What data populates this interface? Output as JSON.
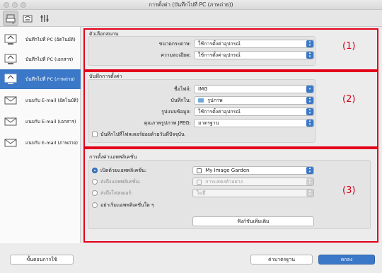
{
  "window": {
    "title": "การตั้งค่า (บันทึกไปที่ PC (ภาพถ่าย))"
  },
  "toolbar": {
    "icons": [
      "scan-settings-icon",
      "general-settings-icon",
      "tools-icon"
    ]
  },
  "sidebar": {
    "items": [
      {
        "label": "บันทึกไปที่ PC (อัตโนมัติ)",
        "icon": "save-to-pc-icon"
      },
      {
        "label": "บันทึกไปที่ PC (เอกสาร)",
        "icon": "save-to-pc-icon"
      },
      {
        "label": "บันทึกไปที่ PC (ภาพถ่าย)",
        "icon": "save-to-pc-icon"
      },
      {
        "label": "แนบกับ E-mail (อัตโนมัติ)",
        "icon": "email-icon"
      },
      {
        "label": "แนบกับ E-mail (เอกสาร)",
        "icon": "email-icon"
      },
      {
        "label": "แนบกับ E-mail (ภาพถ่าย)",
        "icon": "email-icon"
      }
    ],
    "selected_index": 2
  },
  "scan_options": {
    "title": "ตัวเลือกสแกน",
    "paper_size_label": "ขนาดกระดาษ:",
    "paper_size_value": "ใช้การตั้งค่าอุปกรณ์",
    "resolution_label": "ความละเอียด:",
    "resolution_value": "ใช้การตั้งค่าอุปกรณ์",
    "marker": "(1)"
  },
  "save_settings": {
    "title": "บันทึกการตั้งค่า",
    "file_name_label": "ชื่อไฟล์:",
    "file_name_value": "IMG",
    "save_in_label": "บันทึกใน:",
    "save_in_value": "รูปภาพ",
    "data_format_label": "รูปแบบข้อมูล:",
    "data_format_value": "ใช้การตั้งค่าอุปกรณ์",
    "jpeg_quality_label": "คุณภาพรูปภาพ JPEG:",
    "jpeg_quality_value": "มาตรฐาน",
    "subfolder_label": "บันทึกไปที่โฟลเดอร์ย่อยด้วยวันที่ปัจจุบัน",
    "subfolder_checked": false,
    "marker": "(2)"
  },
  "app_settings": {
    "title": "การตั้งค่าแอพพลิเคชั่น",
    "open_with_label": "เปิดด้วยแอพพลิเคชั่น:",
    "open_with_value": "My Image Garden",
    "send_to_app_label": "ส่งถึงแอพพลิเคชั่น:",
    "send_to_app_value": "การแสดงตัวอย่าง",
    "send_to_folder_label": "ส่งถึงโฟลเดอร์:",
    "send_to_folder_value": "ไม่มี",
    "do_not_start_label": "อย่าเริ่มแอพพลิเคชั่นใด ๆ",
    "selected_option": 0,
    "more_functions_label": "ฟังก์ชันเพิ่มเติม",
    "marker": "(3)"
  },
  "footer": {
    "instructions_label": "ขั้นตอนการใช้",
    "defaults_label": "ค่ามาตรฐาน",
    "ok_label": "ตกลง"
  },
  "colors": {
    "accent": "#3b78c7",
    "highlight_red": "#e3001b"
  }
}
